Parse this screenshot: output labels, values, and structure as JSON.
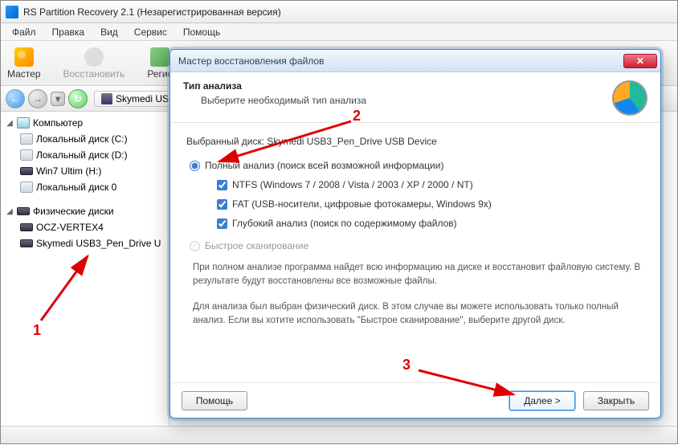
{
  "window": {
    "title": "RS Partition Recovery 2.1 (Незарегистрированная версия)"
  },
  "menubar": {
    "file": "Файл",
    "edit": "Правка",
    "view": "Вид",
    "service": "Сервис",
    "help": "Помощь"
  },
  "toolbar": {
    "wizard": "Мастер",
    "restore": "Восстановить",
    "register": "Регис"
  },
  "navbar": {
    "device": "Skymedi USB3"
  },
  "tree": {
    "computer": "Компьютер",
    "local_c": "Локальный диск (C:)",
    "local_d": "Локальный диск (D:)",
    "win7": "Win7 Ultim (H:)",
    "local_0": "Локальный диск 0",
    "phys_group": "Физические диски",
    "ocz": "OCZ-VERTEX4",
    "skymedi": "Skymedi USB3_Pen_Drive U"
  },
  "dialog": {
    "title": "Мастер восстановления файлов",
    "analysis_type": "Тип анализа",
    "analysis_prompt": "Выберите необходимый тип анализа",
    "selected_disk_label": "Выбранный диск: ",
    "selected_disk_value": "Skymedi USB3_Pen_Drive USB Device",
    "full_scan": "Полный анализ (поиск всей возможной информации)",
    "ntfs": "NTFS (Windows 7 / 2008 / Vista / 2003 / XP / 2000 / NT)",
    "fat": "FAT (USB-носители, цифровые фотокамеры, Windows 9x)",
    "deep": "Глубокий анализ (поиск по содержимому файлов)",
    "quick_scan": "Быстрое сканирование",
    "info1": "При полном анализе программа найдет всю информацию на диске и восстановит файловую систему. В результате будут восстановлены все возможные файлы.",
    "info2": "Для анализа был выбран физический диск. В этом случае вы можете использовать только полный анализ. Если вы хотите использовать \"Быстрое сканирование\", выберите другой диск.",
    "help_btn": "Помощь",
    "next_btn": "Далее >",
    "close_btn": "Закрыть"
  },
  "annotations": {
    "one": "1",
    "two": "2",
    "three": "3"
  }
}
